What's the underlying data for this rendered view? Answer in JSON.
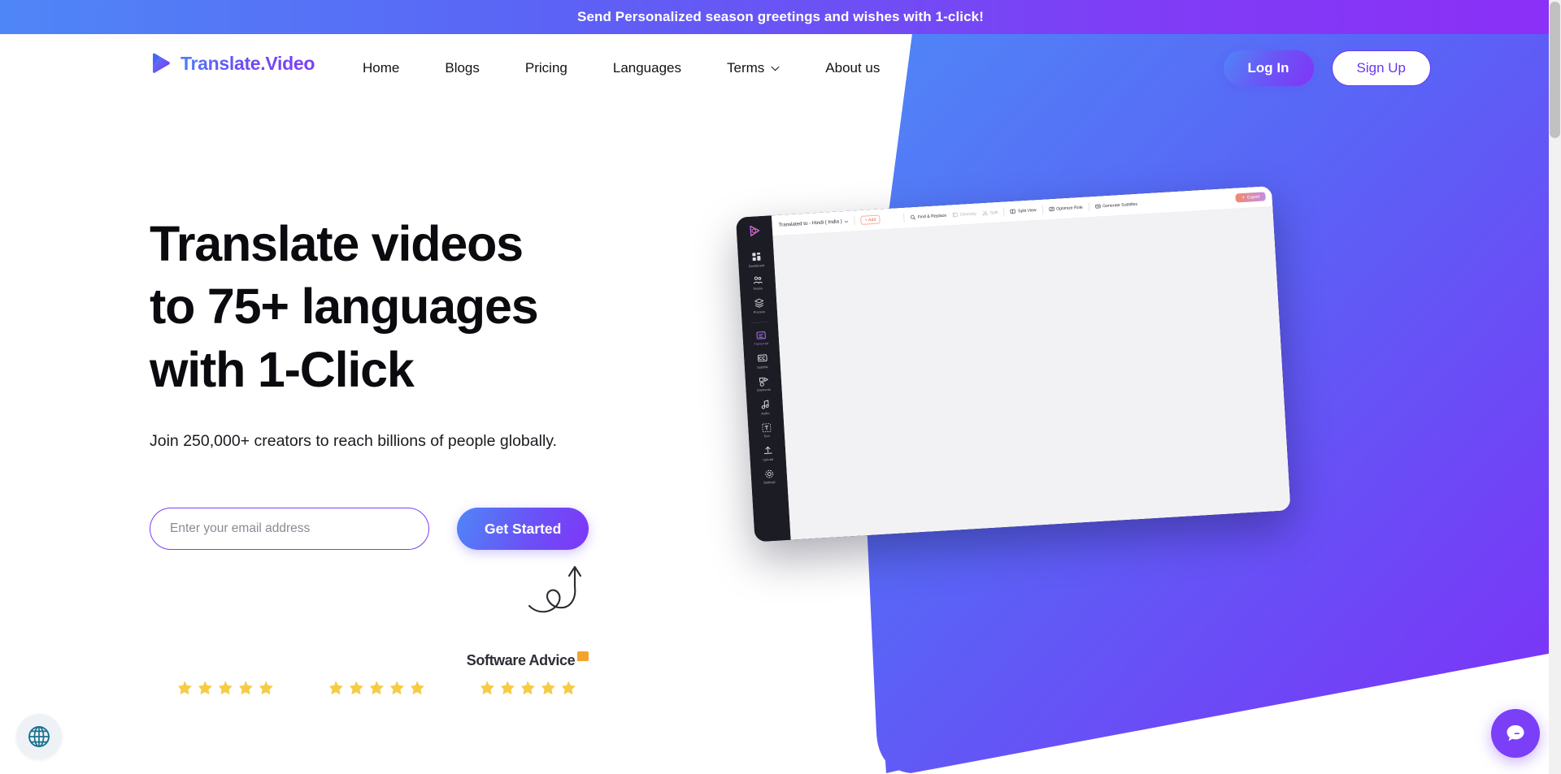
{
  "banner": {
    "text": "Send Personalized season greetings and wishes with 1-click!"
  },
  "header": {
    "brand_name": "Translate.Video",
    "brand_icon": "play-triangle-icon",
    "nav": [
      {
        "label": "Home"
      },
      {
        "label": "Blogs"
      },
      {
        "label": "Pricing"
      },
      {
        "label": "Languages"
      },
      {
        "label": "Terms",
        "has_chevron": true
      },
      {
        "label": "About us"
      }
    ],
    "login_label": "Log In",
    "signup_label": "Sign Up"
  },
  "hero": {
    "title_line1": "Translate videos",
    "title_line2": "to 75+ languages",
    "title_line3": "with 1-Click",
    "subtitle": "Join 250,000+ creators to reach billions of people globally.",
    "email_placeholder": "Enter your email address",
    "email_value": "",
    "cta_label": "Get Started"
  },
  "ratings": [
    {
      "logo": "",
      "stars": 5
    },
    {
      "logo": "",
      "stars": 5
    },
    {
      "logo": "Software Advice",
      "stars": 5
    }
  ],
  "mockup": {
    "sidebar": [
      {
        "label": "Dashboard",
        "icon": "dashboard-icon",
        "active": false
      },
      {
        "label": "Teams",
        "icon": "teams-icon",
        "active": false
      },
      {
        "label": "Process",
        "icon": "process-icon",
        "active": false
      },
      {
        "label": "Transcript",
        "icon": "transcript-icon",
        "active": true
      },
      {
        "label": "Subtitle",
        "icon": "cc-icon",
        "active": false
      },
      {
        "label": "Elements",
        "icon": "elements-icon",
        "active": false
      },
      {
        "label": "Audio",
        "icon": "audio-icon",
        "active": false
      },
      {
        "label": "Text",
        "icon": "text-icon",
        "active": false
      },
      {
        "label": "Upload",
        "icon": "upload-icon",
        "active": false
      },
      {
        "label": "Settings",
        "icon": "gear-icon",
        "active": false
      }
    ],
    "toolbar": {
      "language_label": "Translated to - Hindi ( India )",
      "add_label": "+ Add",
      "find_replace_label": "Find & Replace",
      "glossary_label": "Glossary",
      "split_label": "Split",
      "split_view_label": "Split View",
      "optimize_label": "Optimize Role",
      "generate_subtitles_label": "Generate Subtitles",
      "export_label": "Export"
    }
  },
  "widgets": {
    "globe_icon": "globe-icon",
    "chat_icon": "chat-bubble-icon"
  },
  "colors": {
    "brand_purple": "#7b3ff7",
    "brand_blue": "#4f86f7",
    "star_yellow": "#f6cb45",
    "banner_gradient_start": "#4f86f7",
    "banner_gradient_end": "#8b2ff7"
  }
}
